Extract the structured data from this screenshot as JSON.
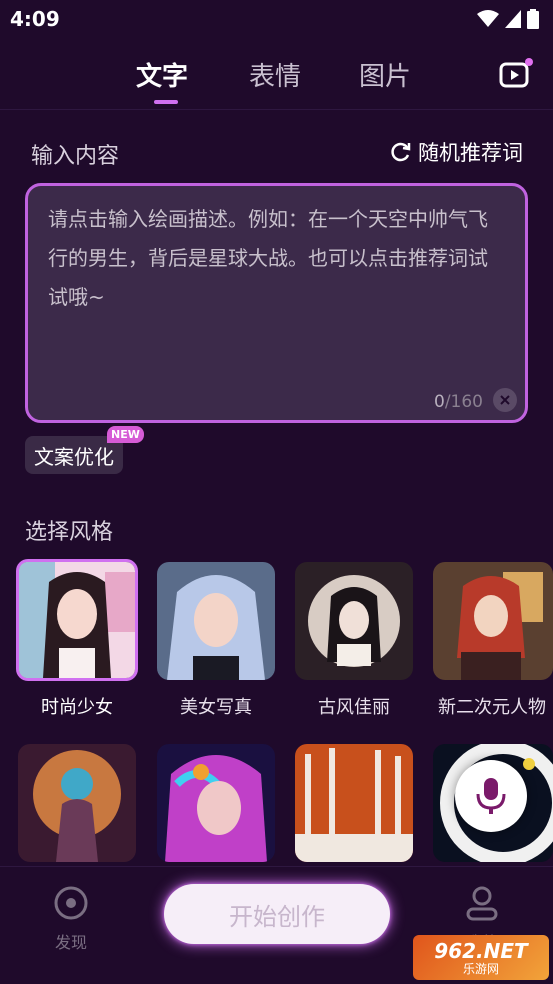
{
  "status_bar": {
    "time": "4:09"
  },
  "tabs": [
    {
      "label": "文字",
      "active": true
    },
    {
      "label": "表情",
      "active": false
    },
    {
      "label": "图片",
      "active": false
    }
  ],
  "input_section": {
    "title": "输入内容",
    "random_label": "随机推荐词",
    "placeholder": "请点击输入绘画描述。例如：在一个天空中帅气飞行的男生，背后是星球大战。也可以点击推荐词试试哦~",
    "count_current": "0",
    "count_max": "/160"
  },
  "optimize": {
    "label": "文案优化",
    "badge": "NEW"
  },
  "style_section": {
    "title": "选择风格",
    "styles": [
      {
        "label": "时尚少女",
        "selected": true
      },
      {
        "label": "美女写真",
        "selected": false
      },
      {
        "label": "古风佳丽",
        "selected": false
      },
      {
        "label": "新二次元人物",
        "selected": false
      }
    ]
  },
  "bottom_nav": {
    "discover": "发现",
    "start": "开始创作",
    "mine": "我的"
  },
  "watermark": {
    "top": "962.NET",
    "bottom": "乐游网"
  },
  "colors": {
    "background": "#1f0a2b",
    "accent": "#d070f0",
    "textarea_bg": "#3c2a4a"
  }
}
